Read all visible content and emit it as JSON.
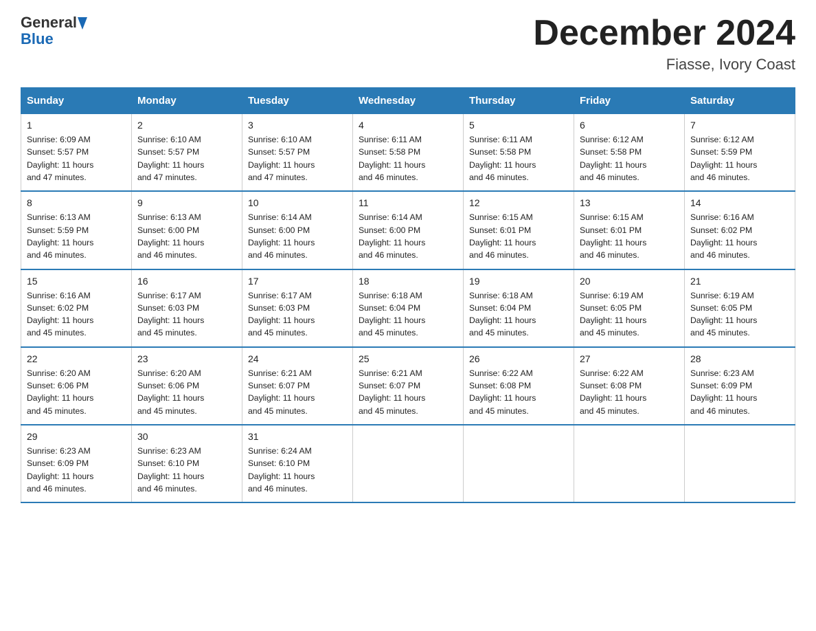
{
  "header": {
    "logo_general": "General",
    "logo_blue": "Blue",
    "month_title": "December 2024",
    "location": "Fiasse, Ivory Coast"
  },
  "days_of_week": [
    "Sunday",
    "Monday",
    "Tuesday",
    "Wednesday",
    "Thursday",
    "Friday",
    "Saturday"
  ],
  "weeks": [
    [
      {
        "day": "1",
        "sunrise": "6:09 AM",
        "sunset": "5:57 PM",
        "daylight": "11 hours and 47 minutes."
      },
      {
        "day": "2",
        "sunrise": "6:10 AM",
        "sunset": "5:57 PM",
        "daylight": "11 hours and 47 minutes."
      },
      {
        "day": "3",
        "sunrise": "6:10 AM",
        "sunset": "5:57 PM",
        "daylight": "11 hours and 47 minutes."
      },
      {
        "day": "4",
        "sunrise": "6:11 AM",
        "sunset": "5:58 PM",
        "daylight": "11 hours and 46 minutes."
      },
      {
        "day": "5",
        "sunrise": "6:11 AM",
        "sunset": "5:58 PM",
        "daylight": "11 hours and 46 minutes."
      },
      {
        "day": "6",
        "sunrise": "6:12 AM",
        "sunset": "5:58 PM",
        "daylight": "11 hours and 46 minutes."
      },
      {
        "day": "7",
        "sunrise": "6:12 AM",
        "sunset": "5:59 PM",
        "daylight": "11 hours and 46 minutes."
      }
    ],
    [
      {
        "day": "8",
        "sunrise": "6:13 AM",
        "sunset": "5:59 PM",
        "daylight": "11 hours and 46 minutes."
      },
      {
        "day": "9",
        "sunrise": "6:13 AM",
        "sunset": "6:00 PM",
        "daylight": "11 hours and 46 minutes."
      },
      {
        "day": "10",
        "sunrise": "6:14 AM",
        "sunset": "6:00 PM",
        "daylight": "11 hours and 46 minutes."
      },
      {
        "day": "11",
        "sunrise": "6:14 AM",
        "sunset": "6:00 PM",
        "daylight": "11 hours and 46 minutes."
      },
      {
        "day": "12",
        "sunrise": "6:15 AM",
        "sunset": "6:01 PM",
        "daylight": "11 hours and 46 minutes."
      },
      {
        "day": "13",
        "sunrise": "6:15 AM",
        "sunset": "6:01 PM",
        "daylight": "11 hours and 46 minutes."
      },
      {
        "day": "14",
        "sunrise": "6:16 AM",
        "sunset": "6:02 PM",
        "daylight": "11 hours and 46 minutes."
      }
    ],
    [
      {
        "day": "15",
        "sunrise": "6:16 AM",
        "sunset": "6:02 PM",
        "daylight": "11 hours and 45 minutes."
      },
      {
        "day": "16",
        "sunrise": "6:17 AM",
        "sunset": "6:03 PM",
        "daylight": "11 hours and 45 minutes."
      },
      {
        "day": "17",
        "sunrise": "6:17 AM",
        "sunset": "6:03 PM",
        "daylight": "11 hours and 45 minutes."
      },
      {
        "day": "18",
        "sunrise": "6:18 AM",
        "sunset": "6:04 PM",
        "daylight": "11 hours and 45 minutes."
      },
      {
        "day": "19",
        "sunrise": "6:18 AM",
        "sunset": "6:04 PM",
        "daylight": "11 hours and 45 minutes."
      },
      {
        "day": "20",
        "sunrise": "6:19 AM",
        "sunset": "6:05 PM",
        "daylight": "11 hours and 45 minutes."
      },
      {
        "day": "21",
        "sunrise": "6:19 AM",
        "sunset": "6:05 PM",
        "daylight": "11 hours and 45 minutes."
      }
    ],
    [
      {
        "day": "22",
        "sunrise": "6:20 AM",
        "sunset": "6:06 PM",
        "daylight": "11 hours and 45 minutes."
      },
      {
        "day": "23",
        "sunrise": "6:20 AM",
        "sunset": "6:06 PM",
        "daylight": "11 hours and 45 minutes."
      },
      {
        "day": "24",
        "sunrise": "6:21 AM",
        "sunset": "6:07 PM",
        "daylight": "11 hours and 45 minutes."
      },
      {
        "day": "25",
        "sunrise": "6:21 AM",
        "sunset": "6:07 PM",
        "daylight": "11 hours and 45 minutes."
      },
      {
        "day": "26",
        "sunrise": "6:22 AM",
        "sunset": "6:08 PM",
        "daylight": "11 hours and 45 minutes."
      },
      {
        "day": "27",
        "sunrise": "6:22 AM",
        "sunset": "6:08 PM",
        "daylight": "11 hours and 45 minutes."
      },
      {
        "day": "28",
        "sunrise": "6:23 AM",
        "sunset": "6:09 PM",
        "daylight": "11 hours and 46 minutes."
      }
    ],
    [
      {
        "day": "29",
        "sunrise": "6:23 AM",
        "sunset": "6:09 PM",
        "daylight": "11 hours and 46 minutes."
      },
      {
        "day": "30",
        "sunrise": "6:23 AM",
        "sunset": "6:10 PM",
        "daylight": "11 hours and 46 minutes."
      },
      {
        "day": "31",
        "sunrise": "6:24 AM",
        "sunset": "6:10 PM",
        "daylight": "11 hours and 46 minutes."
      },
      null,
      null,
      null,
      null
    ]
  ]
}
